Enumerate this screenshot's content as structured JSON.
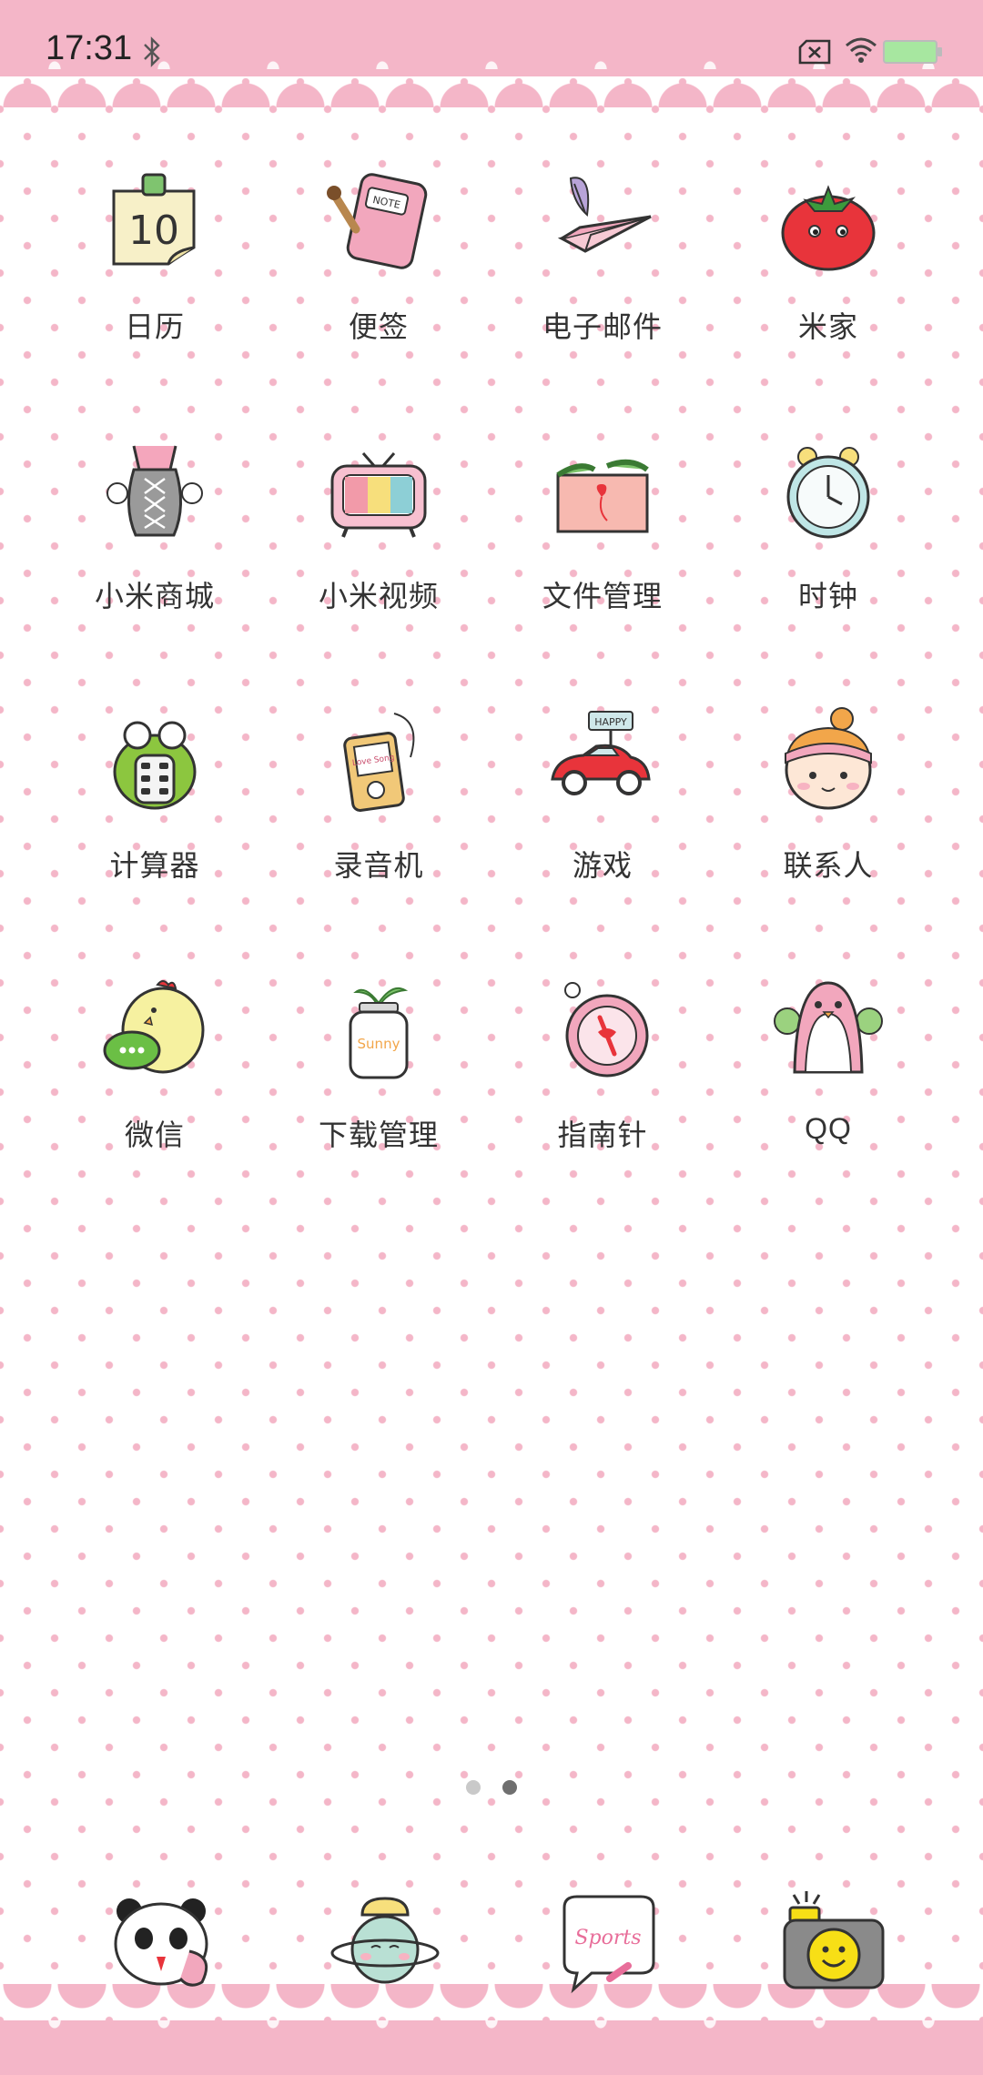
{
  "status_bar": {
    "time": "17:31",
    "icons": [
      "bluetooth-icon",
      "no-sim-icon",
      "wifi-icon",
      "battery-icon"
    ],
    "battery_color": "#a7e7a0"
  },
  "apps": [
    {
      "label": "日历",
      "icon": "calendar-icon"
    },
    {
      "label": "便签",
      "icon": "notes-icon"
    },
    {
      "label": "电子邮件",
      "icon": "email-icon"
    },
    {
      "label": "米家",
      "icon": "mijia-tomato-icon"
    },
    {
      "label": "小米商城",
      "icon": "mi-store-icon"
    },
    {
      "label": "小米视频",
      "icon": "mi-video-tv-icon"
    },
    {
      "label": "文件管理",
      "icon": "file-manager-envelope-icon"
    },
    {
      "label": "时钟",
      "icon": "alarm-clock-icon"
    },
    {
      "label": "计算器",
      "icon": "calculator-frog-icon"
    },
    {
      "label": "录音机",
      "icon": "recorder-icon"
    },
    {
      "label": "游戏",
      "icon": "games-car-icon"
    },
    {
      "label": "联系人",
      "icon": "contacts-girl-icon"
    },
    {
      "label": "微信",
      "icon": "wechat-chick-icon"
    },
    {
      "label": "下载管理",
      "icon": "download-jar-icon"
    },
    {
      "label": "指南针",
      "icon": "compass-icon"
    },
    {
      "label": "QQ",
      "icon": "qq-penguin-icon"
    }
  ],
  "calendar_day": "10",
  "notes_tag": "NOTE",
  "games_sign": "HAPPY",
  "recorder_text": "Love Song",
  "jar_text": "Sunny",
  "dock_sports_text": "Sports",
  "page_indicator": {
    "pages": 2,
    "current": 2
  },
  "dock": [
    {
      "icon": "phone-panda-icon"
    },
    {
      "icon": "messages-planet-icon"
    },
    {
      "icon": "browser-speech-bubble-icon"
    },
    {
      "icon": "camera-smiley-icon"
    }
  ],
  "colors": {
    "lace_pink": "#f4b6c8",
    "label_text": "#333333"
  }
}
